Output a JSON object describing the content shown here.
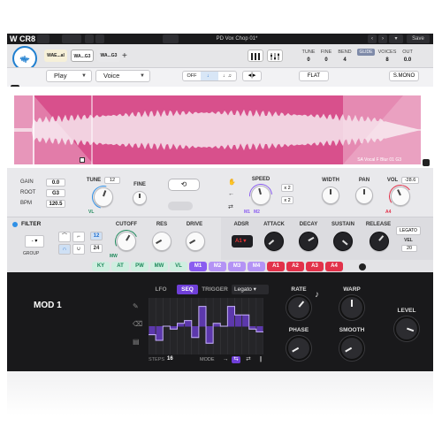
{
  "app": {
    "logo": "W CR8",
    "window_title": "PD Vox Chop 01*",
    "save_label": "Save"
  },
  "header": {
    "sample_tabs": [
      {
        "label": "WAE...al",
        "color": "#f6f0d8"
      },
      {
        "label": "WA...G3",
        "color": "#f4f4f4"
      },
      {
        "label": "WA...G3",
        "color": "#e8e8ea"
      }
    ],
    "add_label": "+",
    "tune_label": "TUNE",
    "tune_value": "0",
    "fine_label": "FINE",
    "fine_value": "0",
    "bend_label": "BEND",
    "bend_value": "4",
    "glide_label": "GLIDE",
    "voices_label": "VOICES",
    "voices_value": "8",
    "out_label": "OUT",
    "out_value": "0.0"
  },
  "sample_bar": {
    "play_mode": "Play",
    "sample_type": "Voice",
    "direction_options": [
      "OFF",
      "♩",
      "♩♫"
    ],
    "direction_selected": 1,
    "flat_label": "FLAT",
    "mono_label": "S.MONO"
  },
  "waveform": {
    "color": "#d8508c",
    "sample_name": "SA Vocal F Blur 01 G3"
  },
  "synth": {
    "gain_label": "GAIN",
    "gain_value": "0.0",
    "root_label": "ROOT",
    "root_value": "G3",
    "bpm_label": "BPM",
    "bpm_value": "120.5",
    "tune_label": "TUNE",
    "tune_value": "12",
    "tune_mod_tag": "VL",
    "fine_label": "FINE",
    "speed_label": "SPEED",
    "speed_mod_tags": [
      "M1",
      "M2"
    ],
    "speed_mult": [
      "x 2",
      "x 2"
    ],
    "width_label": "WIDTH",
    "pan_label": "PAN",
    "vol_label": "VOL",
    "vol_value": "-28.6",
    "vol_mod_tag": "A4",
    "filter_label": "FILTER",
    "group_label": "GROUP",
    "group_value": "- ▾",
    "slopes": [
      "12",
      "24"
    ],
    "cutoff_label": "CUTOFF",
    "cutoff_mod_tag": "MW",
    "res_label": "RES",
    "drive_label": "DRIVE",
    "adsr_label": "ADSR",
    "adsr_target": "A1 ▾",
    "attack_label": "ATTACK",
    "decay_label": "DECAY",
    "sustain_label": "SUSTAIN",
    "release_label": "RELEASE",
    "legato_label": "LEGATO",
    "vel_label": "VEL",
    "vel_value": "20"
  },
  "mod_tabs": [
    {
      "label": "KY",
      "bg": "#cfeee0",
      "fg": "#1f8a5c"
    },
    {
      "label": "AT",
      "bg": "#cfeee0",
      "fg": "#1f8a5c"
    },
    {
      "label": "PW",
      "bg": "#cfeee0",
      "fg": "#1f8a5c"
    },
    {
      "label": "MW",
      "bg": "#cfeee0",
      "fg": "#1f8a5c"
    },
    {
      "label": "VL",
      "bg": "#cfeee0",
      "fg": "#1f8a5c"
    },
    {
      "label": "M1",
      "bg": "#8a5cf0",
      "fg": "#ffffff"
    },
    {
      "label": "M2",
      "bg": "#b493f5",
      "fg": "#ffffff"
    },
    {
      "label": "M3",
      "bg": "#b493f5",
      "fg": "#ffffff"
    },
    {
      "label": "M4",
      "bg": "#b493f5",
      "fg": "#ffffff"
    },
    {
      "label": "A1",
      "bg": "#e2324a",
      "fg": "#ffffff"
    },
    {
      "label": "A2",
      "bg": "#e2324a",
      "fg": "#ffffff"
    },
    {
      "label": "A3",
      "bg": "#e2324a",
      "fg": "#ffffff"
    },
    {
      "label": "A4",
      "bg": "#e2324a",
      "fg": "#ffffff"
    }
  ],
  "mod": {
    "title": "MOD 1",
    "tabs": [
      "LFO",
      "SEQ",
      "TRIGGER"
    ],
    "active_tab": 1,
    "trigger_value": "Legato ▾",
    "steps_label": "STEPS",
    "steps_value": "16",
    "mode_label": "MODE",
    "seq_values": [
      0.35,
      0.25,
      0.5,
      0.45,
      0.55,
      0.6,
      0.3,
      0.85,
      0.2,
      0.55,
      0.5,
      0.85,
      0.7,
      0.7,
      0.45,
      0.4
    ],
    "rate_label": "RATE",
    "warp_label": "WARP",
    "phase_label": "PHASE",
    "smooth_label": "SMOOTH",
    "level_label": "LEVEL"
  }
}
